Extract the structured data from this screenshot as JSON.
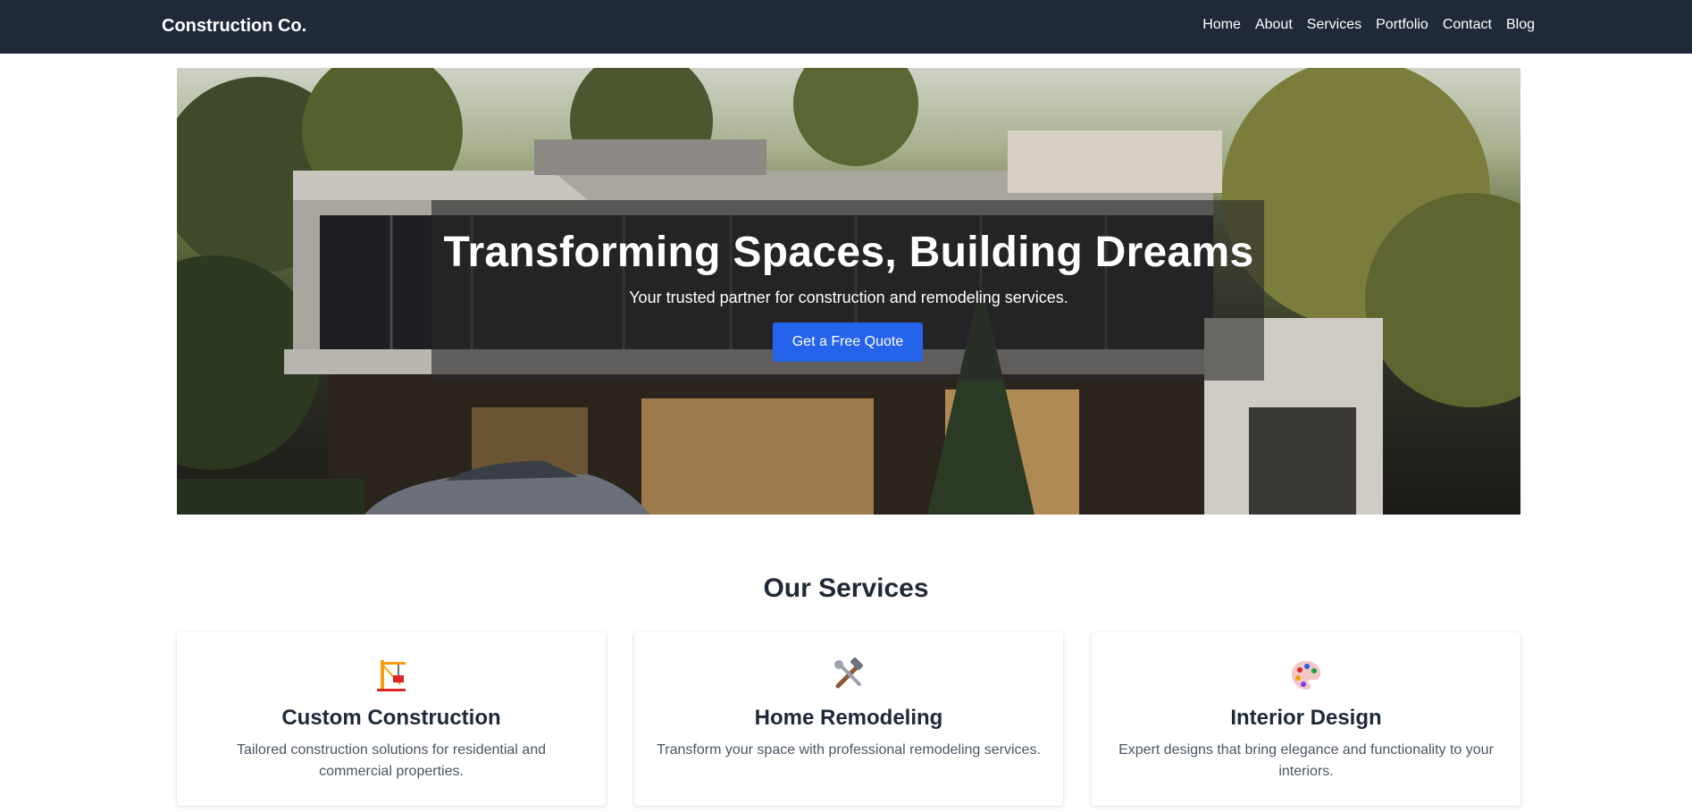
{
  "nav": {
    "brand": "Construction Co.",
    "links": [
      "Home",
      "About",
      "Services",
      "Portfolio",
      "Contact",
      "Blog"
    ]
  },
  "hero": {
    "title": "Transforming Spaces, Building Dreams",
    "subtitle": "Your trusted partner for construction and remodeling services.",
    "cta_label": "Get a Free Quote",
    "image_icon": "house-photo"
  },
  "services": {
    "title": "Our Services",
    "items": [
      {
        "title": "Custom Construction",
        "description": "Tailored construction solutions for residential and commercial properties.",
        "icon": "crane-icon"
      },
      {
        "title": "Home Remodeling",
        "description": "Transform your space with professional remodeling services.",
        "icon": "tools-icon"
      },
      {
        "title": "Interior Design",
        "description": "Expert designs that bring elegance and functionality to your interiors.",
        "icon": "palette-icon"
      }
    ]
  },
  "colors": {
    "navbar": "#1f2937",
    "accent": "#2563eb",
    "text": "#1f2937",
    "muted": "#4b5563"
  }
}
